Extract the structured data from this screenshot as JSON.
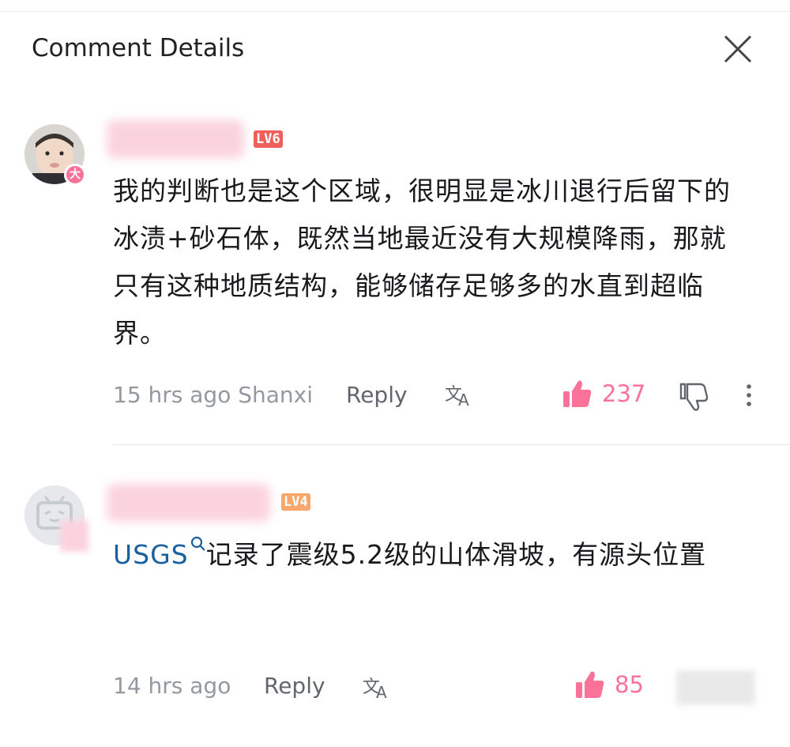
{
  "header": {
    "title": "Comment Details"
  },
  "comments": [
    {
      "level": "LV6",
      "level_color": "#f0605a",
      "avatar_badge": "大",
      "content": "我的判断也是这个区域，很明显是冰川退行后留下的冰渍+砂石体，既然当地最近没有大规模降雨，那就只有这种地质结构，能够储存足够多的水直到超临界。",
      "time_location": "15 hrs ago Shanxi",
      "reply_label": "Reply",
      "likes": "237"
    },
    {
      "level": "LV4",
      "level_color": "#f9a66a",
      "link_text": "USGS",
      "content": "记录了震级5.2级的山体滑坡，有源头位置",
      "time": "14 hrs ago",
      "reply_label": "Reply",
      "likes": "85"
    }
  ],
  "colors": {
    "accent": "#fb7299",
    "link": "#1a5f9e"
  }
}
